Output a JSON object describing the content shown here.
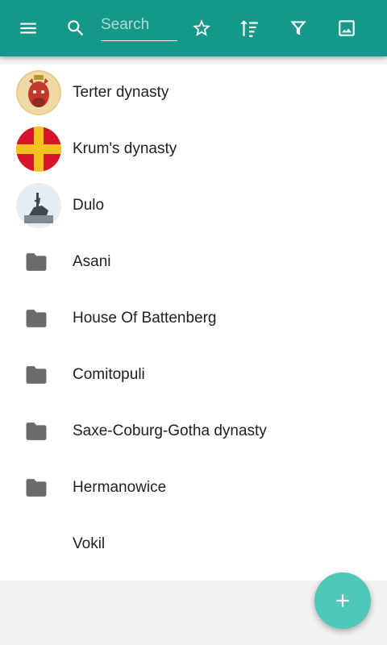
{
  "toolbar": {
    "search": {
      "placeholder": "Search",
      "value": ""
    },
    "icons": [
      "menu-icon",
      "search-icon",
      "star-icon",
      "sort-icon",
      "filter-icon",
      "image-icon"
    ],
    "color": "#15978a"
  },
  "list": {
    "items": [
      {
        "label": "Terter dynasty",
        "icon": "avatar-terter"
      },
      {
        "label": "Krum's dynasty",
        "icon": "avatar-krum"
      },
      {
        "label": "Dulo",
        "icon": "avatar-dulo"
      },
      {
        "label": "Asani",
        "icon": "folder-icon"
      },
      {
        "label": "House Of Battenberg",
        "icon": "folder-icon"
      },
      {
        "label": "Comitopuli",
        "icon": "folder-icon"
      },
      {
        "label": "Saxe-Coburg-Gotha dynasty",
        "icon": "folder-icon"
      },
      {
        "label": "Hermanowice",
        "icon": "folder-icon"
      },
      {
        "label": "Vokil",
        "icon": "none"
      }
    ]
  },
  "fab": {
    "icon": "plus-icon",
    "color": "#4fc8b8"
  }
}
